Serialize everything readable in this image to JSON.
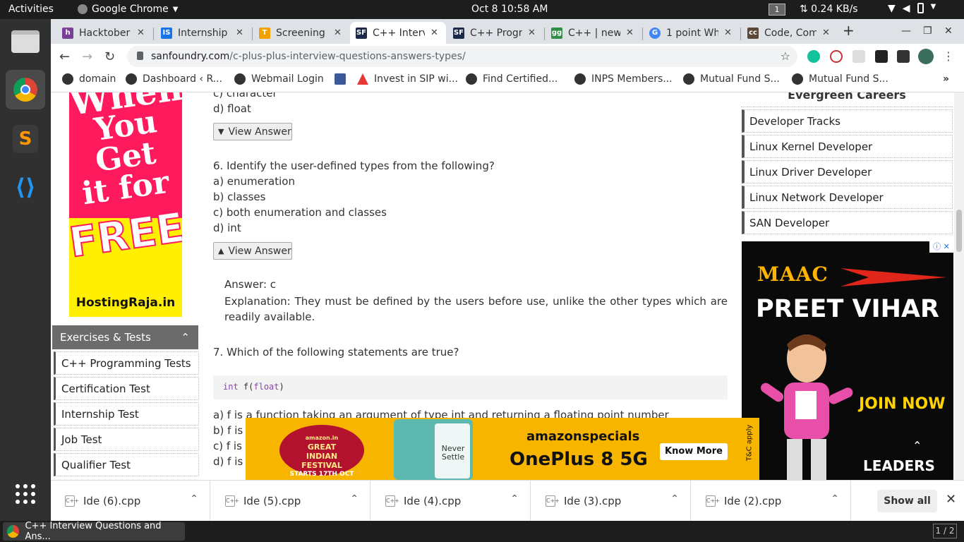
{
  "system_bar": {
    "activities": "Activities",
    "app_menu": "Google Chrome",
    "clock": "Oct 8  10:58 AM",
    "workspace": "1",
    "network_speed": "⇅ 0.24 KB/s",
    "tray_icons": [
      "wifi-icon",
      "volume-icon",
      "battery-icon",
      "power-menu-icon"
    ]
  },
  "dock": {
    "apps": [
      "files-icon",
      "chrome-icon",
      "sublime-text-icon",
      "vscode-icon"
    ],
    "show_apps": "show-apps-icon"
  },
  "taskbar": {
    "window_title": "C++ Interview Questions and Ans...",
    "pager": "1 / 2"
  },
  "tabs": [
    {
      "label": "Hacktober",
      "favicon": "hacktober-icon",
      "color": "#7b3f98"
    },
    {
      "label": "Internship",
      "favicon": "internship-icon",
      "color": "#1a73e8"
    },
    {
      "label": "Screening",
      "favicon": "screening-icon",
      "color": "#f4a100"
    },
    {
      "label": "C++ Intervi",
      "favicon": "sanfoundry-icon",
      "color": "#1b2a4a",
      "active": true
    },
    {
      "label": "C++ Progra",
      "favicon": "sanfoundry-icon",
      "color": "#1b2a4a"
    },
    {
      "label": "C++ | new a",
      "favicon": "geeksforgeeks-icon",
      "color": "#2f8d46"
    },
    {
      "label": "1 point Wh",
      "favicon": "google-icon",
      "color": "#4285f4"
    },
    {
      "label": "Code, Com",
      "favicon": "codechef-icon",
      "color": "#5b4638"
    }
  ],
  "address": {
    "host": "sanfoundry.com",
    "path": "/c-plus-plus-interview-questions-answers-types/"
  },
  "extensions": [
    "grammarly-icon",
    "ext-red-icon",
    "ext-gray-icon",
    "ext-bird-icon",
    "extensions-puzzle-icon",
    "profile-avatar"
  ],
  "bookmarks": [
    {
      "label": "domain"
    },
    {
      "label": "Dashboard ‹ R..."
    },
    {
      "label": "Webmail Login"
    },
    {
      "label": ""
    },
    {
      "label": "Invest in SIP wi..."
    },
    {
      "label": "Find Certified..."
    },
    {
      "label": "INPS Members..."
    },
    {
      "label": "Mutual Fund S..."
    },
    {
      "label": "Mutual Fund S..."
    }
  ],
  "left_ad": {
    "headline": [
      "When",
      "You",
      "Get",
      "it for"
    ],
    "free": "FREE",
    "brand": "HostingRaja.in"
  },
  "exercises": {
    "title": "Exercises & Tests",
    "items": [
      "C++ Programming Tests",
      "Certification Test",
      "Internship Test",
      "Job Test",
      "Qualifier Test"
    ]
  },
  "content": {
    "q5_tail": [
      "c) character",
      "d) float"
    ],
    "view_answer": "View Answer",
    "q6": {
      "question": "6. Identify the user-defined types from the following?",
      "options": [
        "a) enumeration",
        "b) classes",
        "c) both enumeration and classes",
        "d) int"
      ],
      "answer": "Answer: c",
      "explanation": "Explanation: They must be defined by the users before use, unlike the other types which are readily available."
    },
    "q7": {
      "question": "7. Which of the following statements are true?",
      "code_kw1": "int",
      "code_fn": " f(",
      "code_kw2": "float",
      "code_end": ")",
      "options": [
        "a) f is a function taking an argument of type int and returning a floating point number",
        "b) f is a",
        "c) f is a",
        "d) f is a"
      ]
    }
  },
  "right_sidebar": {
    "title": "Evergreen Careers",
    "items": [
      "Developer Tracks",
      "Linux Kernel Developer",
      "Linux Driver Developer",
      "Linux Network Developer",
      "SAN Developer"
    ]
  },
  "right_ad": {
    "brand": "MAAC",
    "location": "PREET VIHAR",
    "cta": "JOIN NOW",
    "tagline": "LEADERS"
  },
  "bottom_ad": {
    "festival": [
      "amazon.in",
      "GREAT",
      "INDIAN",
      "FESTIVAL",
      "STARTS 17TH OCT"
    ],
    "phone_text": "Never Settle",
    "brand": "amazonspecials",
    "product": "OnePlus 8 5G",
    "cta": "Know More",
    "fine_print": "T&C apply"
  },
  "downloads": {
    "files": [
      "Ide (6).cpp",
      "Ide (5).cpp",
      "Ide (4).cpp",
      "Ide (3).cpp",
      "Ide (2).cpp"
    ],
    "show_all": "Show all"
  },
  "colors": {
    "accent_ad_pink": "#ff1a5e",
    "accent_ad_yellow": "#ffef00",
    "bottom_ad_bg": "#f7b500",
    "sidebar_head": "#6b6b6b"
  }
}
